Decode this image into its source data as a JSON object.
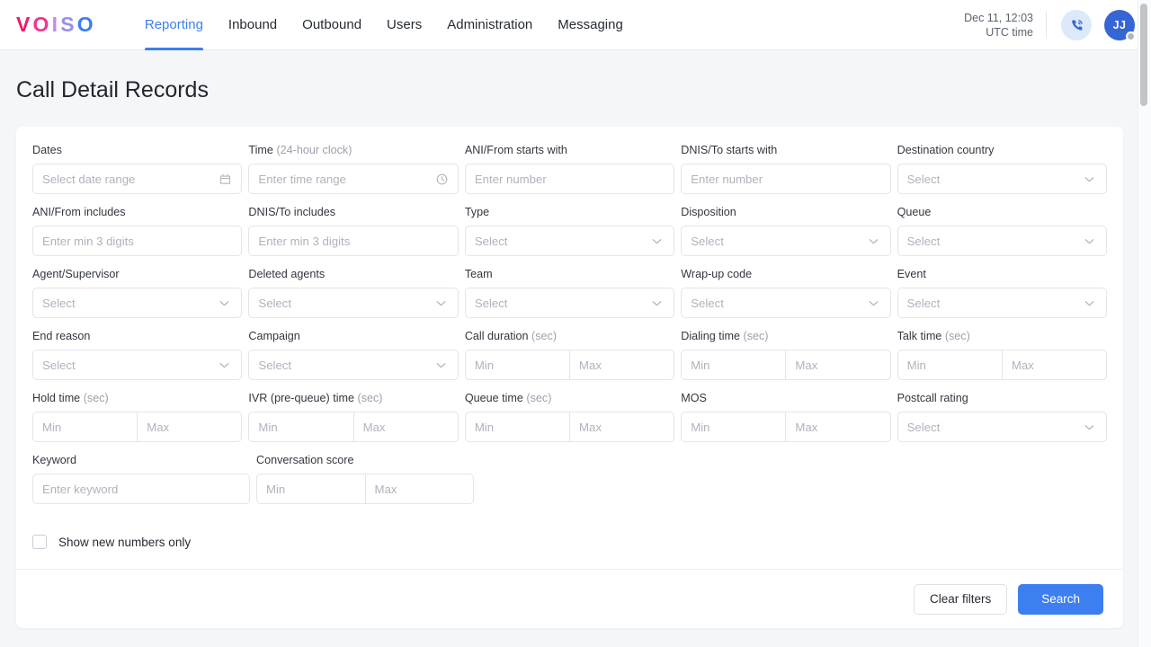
{
  "header": {
    "logo": {
      "letters": [
        {
          "char": "V",
          "color": "#f4176b"
        },
        {
          "char": "O",
          "color": "#f0368f"
        },
        {
          "char": "I",
          "color": "#c489e8"
        },
        {
          "char": "S",
          "color": "#9a8fe8"
        },
        {
          "char": "O",
          "color": "#3d7ef0"
        }
      ]
    },
    "nav": [
      {
        "label": "Reporting",
        "active": true
      },
      {
        "label": "Inbound",
        "active": false
      },
      {
        "label": "Outbound",
        "active": false
      },
      {
        "label": "Users",
        "active": false
      },
      {
        "label": "Administration",
        "active": false
      },
      {
        "label": "Messaging",
        "active": false
      }
    ],
    "clock_line1": "Dec 11, 12:03",
    "clock_line2": "UTC time",
    "phone_icon": "phone-call-icon",
    "avatar_initials": "JJ",
    "accent_color": "#3d7ef0"
  },
  "page": {
    "title": "Call Detail Records"
  },
  "filters": {
    "rows": [
      [
        {
          "label": "Dates",
          "sub": "",
          "kind": "input",
          "placeholder": "Select date range",
          "icon": "calendar-icon",
          "name": "dates"
        },
        {
          "label": "Time",
          "sub": "(24-hour clock)",
          "kind": "input",
          "placeholder": "Enter time range",
          "icon": "clock-icon",
          "name": "time"
        },
        {
          "label": "ANI/From starts with",
          "sub": "",
          "kind": "input",
          "placeholder": "Enter number",
          "icon": "",
          "name": "ani-from-starts-with"
        },
        {
          "label": "DNIS/To starts with",
          "sub": "",
          "kind": "input",
          "placeholder": "Enter number",
          "icon": "",
          "name": "dnis-to-starts-with"
        },
        {
          "label": "Destination country",
          "sub": "",
          "kind": "select",
          "placeholder": "Select",
          "icon": "chevron-down-icon",
          "name": "destination-country"
        }
      ],
      [
        {
          "label": "ANI/From includes",
          "sub": "",
          "kind": "input",
          "placeholder": "Enter min 3 digits",
          "icon": "",
          "name": "ani-from-includes"
        },
        {
          "label": "DNIS/To includes",
          "sub": "",
          "kind": "input",
          "placeholder": "Enter min 3 digits",
          "icon": "",
          "name": "dnis-to-includes"
        },
        {
          "label": "Type",
          "sub": "",
          "kind": "select",
          "placeholder": "Select",
          "icon": "chevron-down-icon",
          "name": "type"
        },
        {
          "label": "Disposition",
          "sub": "",
          "kind": "select",
          "placeholder": "Select",
          "icon": "chevron-down-icon",
          "name": "disposition"
        },
        {
          "label": "Queue",
          "sub": "",
          "kind": "select",
          "placeholder": "Select",
          "icon": "chevron-down-icon",
          "name": "queue"
        }
      ],
      [
        {
          "label": "Agent/Supervisor",
          "sub": "",
          "kind": "select",
          "placeholder": "Select",
          "icon": "chevron-down-icon",
          "name": "agent-supervisor"
        },
        {
          "label": "Deleted agents",
          "sub": "",
          "kind": "select",
          "placeholder": "Select",
          "icon": "chevron-down-icon",
          "name": "deleted-agents"
        },
        {
          "label": "Team",
          "sub": "",
          "kind": "select",
          "placeholder": "Select",
          "icon": "chevron-down-icon",
          "name": "team"
        },
        {
          "label": "Wrap-up code",
          "sub": "",
          "kind": "select",
          "placeholder": "Select",
          "icon": "chevron-down-icon",
          "name": "wrap-up-code"
        },
        {
          "label": "Event",
          "sub": "",
          "kind": "select",
          "placeholder": "Select",
          "icon": "chevron-down-icon",
          "name": "event"
        }
      ],
      [
        {
          "label": "End reason",
          "sub": "",
          "kind": "select",
          "placeholder": "Select",
          "icon": "chevron-down-icon",
          "name": "end-reason"
        },
        {
          "label": "Campaign",
          "sub": "",
          "kind": "select",
          "placeholder": "Select",
          "icon": "chevron-down-icon",
          "name": "campaign"
        },
        {
          "label": "Call duration",
          "sub": "(sec)",
          "kind": "range",
          "placeholder_min": "Min",
          "placeholder_max": "Max",
          "name": "call-duration"
        },
        {
          "label": "Dialing time",
          "sub": "(sec)",
          "kind": "range",
          "placeholder_min": "Min",
          "placeholder_max": "Max",
          "name": "dialing-time"
        },
        {
          "label": "Talk time",
          "sub": "(sec)",
          "kind": "range",
          "placeholder_min": "Min",
          "placeholder_max": "Max",
          "name": "talk-time"
        }
      ],
      [
        {
          "label": "Hold time",
          "sub": "(sec)",
          "kind": "range",
          "placeholder_min": "Min",
          "placeholder_max": "Max",
          "name": "hold-time"
        },
        {
          "label": "IVR (pre-queue) time",
          "sub": "(sec)",
          "kind": "range",
          "placeholder_min": "Min",
          "placeholder_max": "Max",
          "name": "ivr-time"
        },
        {
          "label": "Queue time",
          "sub": "(sec)",
          "kind": "range",
          "placeholder_min": "Min",
          "placeholder_max": "Max",
          "name": "queue-time"
        },
        {
          "label": "MOS",
          "sub": "",
          "kind": "range",
          "placeholder_min": "Min",
          "placeholder_max": "Max",
          "name": "mos"
        },
        {
          "label": "Postcall rating",
          "sub": "",
          "kind": "select",
          "placeholder": "Select",
          "icon": "chevron-down-icon",
          "name": "postcall-rating"
        }
      ],
      [
        {
          "label": "Keyword",
          "sub": "",
          "kind": "input",
          "placeholder": "Enter keyword",
          "icon": "",
          "name": "keyword"
        },
        {
          "label": "Conversation score",
          "sub": "",
          "kind": "range",
          "placeholder_min": "Min",
          "placeholder_max": "Max",
          "name": "conversation-score"
        }
      ]
    ],
    "checkbox": {
      "label": "Show new numbers only",
      "checked": false
    }
  },
  "actions": {
    "clear_label": "Clear filters",
    "search_label": "Search"
  }
}
